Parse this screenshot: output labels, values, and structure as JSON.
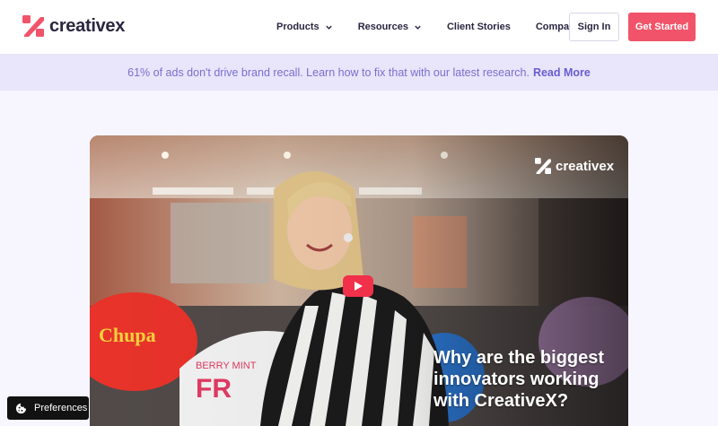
{
  "brand": {
    "name": "creativex",
    "accent": "#f1546a",
    "logo_icon": "x-logo-icon"
  },
  "nav": {
    "items": [
      {
        "label": "Products",
        "has_dropdown": true
      },
      {
        "label": "Resources",
        "has_dropdown": true
      },
      {
        "label": "Client Stories",
        "has_dropdown": false
      },
      {
        "label": "Company",
        "has_dropdown": true
      }
    ],
    "sign_in": "Sign In",
    "get_started": "Get Started"
  },
  "banner": {
    "text": "61% of ads don't drive brand recall. Learn how to fix that with our latest research.",
    "link": "Read More"
  },
  "video": {
    "logo_text": "creativex",
    "headline": "Why are the biggest innovators working with CreativeX?",
    "play_icon": "play-icon"
  },
  "preferences": {
    "label": "Preferences",
    "icon": "cookie-icon"
  }
}
